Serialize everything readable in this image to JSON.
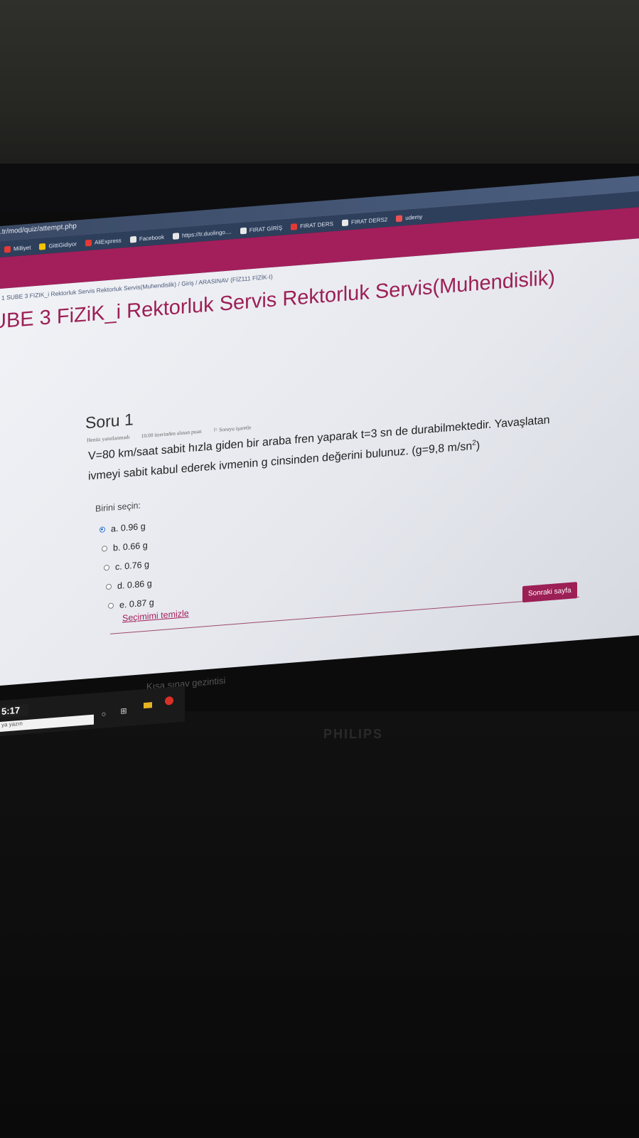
{
  "browser": {
    "url": ".tr/mod/quiz/attempt.php",
    "bookmarks": [
      {
        "label": "Milliyet",
        "icon": "milliyet-icon",
        "color": "#e53935"
      },
      {
        "label": "GittiGidiyor",
        "icon": "gittigidiyor-icon",
        "color": "#f5c400"
      },
      {
        "label": "AliExpress",
        "icon": "aliexpress-icon",
        "color": "#e53935"
      },
      {
        "label": "Facebook",
        "icon": "page-icon",
        "color": "#e8e8e8"
      },
      {
        "label": "https://tr.duolingo....",
        "icon": "grid-icon",
        "color": "#e8e8e8"
      },
      {
        "label": "FIRAT GİRİŞ",
        "icon": "page-icon",
        "color": "#e8e8e8"
      },
      {
        "label": "FIRAT DERS",
        "icon": "firat-icon",
        "color": "#e53935"
      },
      {
        "label": "FIRAT DERS2",
        "icon": "page-icon",
        "color": "#e8e8e8"
      },
      {
        "label": "udemy",
        "icon": "udemy-icon",
        "color": "#ec5252"
      }
    ]
  },
  "breadcrumb": {
    "course": "1 SUBE 3 FIZIK_i Rektorluk Servis Rektorluk Servis(Muhendislik)",
    "sep1": "/",
    "section": "Giriş",
    "sep2": "/",
    "quiz": "ARASINAV (FİZ111 FİZİK-I)"
  },
  "page_title": "UBE 3 FiZiK_i Rektorluk Servis Rektorluk Servis(Muhendislik)",
  "question": {
    "heading": "Soru 1",
    "status": "Henüz yanıtlanmadı",
    "points": "10.00 üzerinden alınan puan",
    "flag": "Soruyu işaretle",
    "text_line1": "V=80 km/saat sabit hızla giden bir araba fren yaparak t=3 sn de durabilmektedir. Yavaşlatan",
    "text_line2_pre": "ivmeyi sabit kabul ederek ivmenin g cinsinden değerini bulunuz. (g=9,8 m/sn",
    "text_sup": "2",
    "text_line2_post": ")",
    "prompt": "Birini seçin:",
    "options": [
      {
        "label": "a. 0.96 g",
        "selected": true
      },
      {
        "label": "b. 0.66 g",
        "selected": false
      },
      {
        "label": "c. 0.76 g",
        "selected": false
      },
      {
        "label": "d. 0.86 g",
        "selected": false
      },
      {
        "label": "e. 0.87 g",
        "selected": false
      }
    ],
    "clear_label": "Seçimimi temizle"
  },
  "next_button": "Sonraki sayfa",
  "quiz_nav_peek": "Kısa sınav gezintisi",
  "taskbar": {
    "clock": "5:17",
    "search_hint": "ya yazın"
  },
  "monitor_brand": "PHILIPS",
  "colors": {
    "brand": "#9c1f56",
    "header_band": "#a31f5c",
    "link": "#a31f5c",
    "radio_selected": "#2c6fcf"
  }
}
